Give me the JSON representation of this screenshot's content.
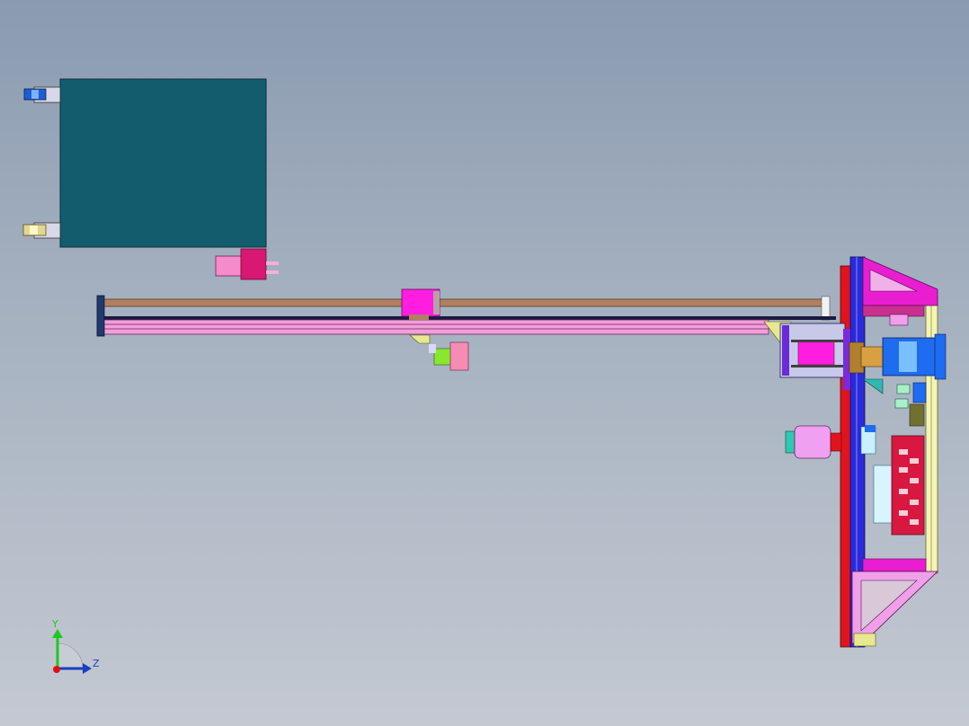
{
  "viewport": {
    "background_top": "#8a9bb0",
    "background_bottom": "#c4c9d2"
  },
  "model": {
    "tank_color": "#135c6e",
    "rail_color": "#b08060",
    "frame_red": "#e0141e",
    "frame_blue": "#2a2ad8",
    "magenta": "#e81ed0",
    "pink_light": "#f0b0e8",
    "yellow_light": "#f4f4b8"
  },
  "triad": {
    "y_label": "Y",
    "z_label": "Z",
    "y_color": "#1ec81e",
    "z_color": "#1a3fbf",
    "x_color": "#e01010"
  }
}
